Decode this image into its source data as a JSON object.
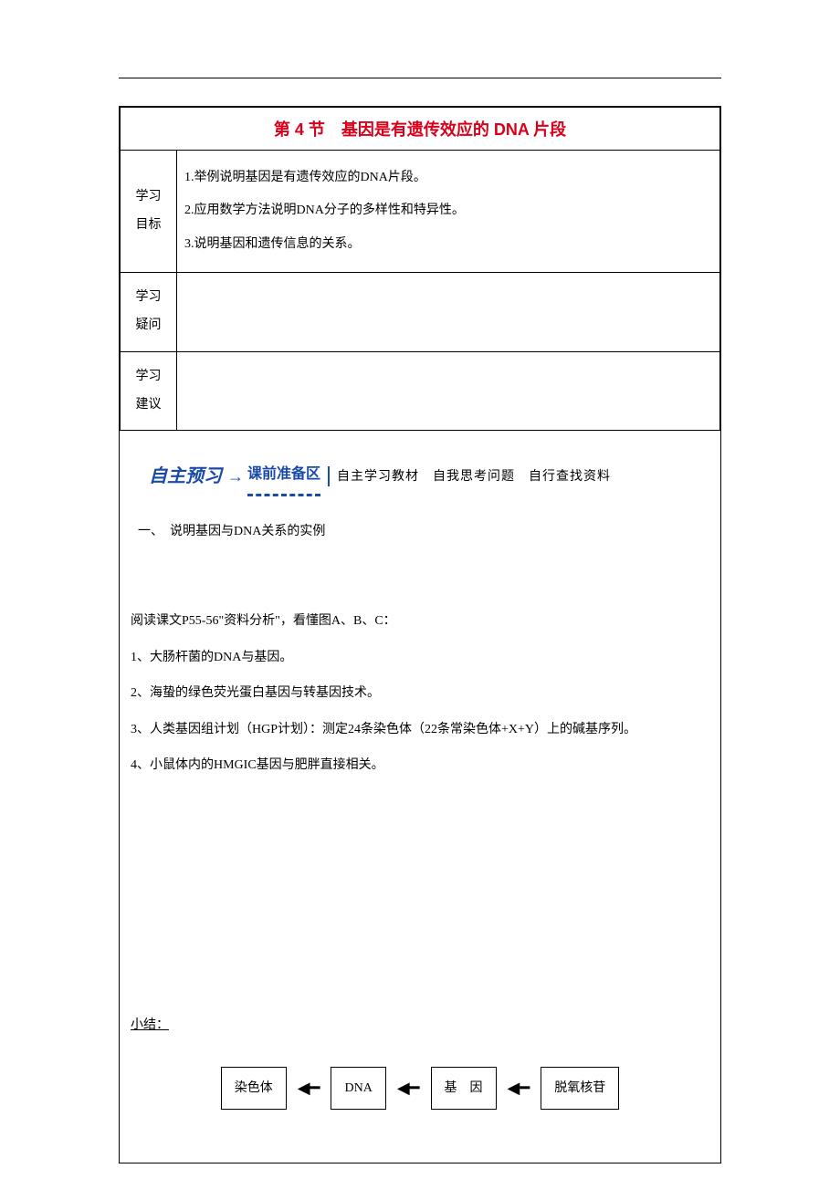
{
  "title": "第 4 节　基因是有遗传效应的 DNA 片段",
  "goals": {
    "label": "学习\n目标",
    "items": [
      "1.举例说明基因是有遗传效应的DNA片段。",
      "2.应用数学方法说明DNA分子的多样性和特异性。",
      "3.说明基因和遗传信息的关系。"
    ]
  },
  "questions_label": "学习\n疑问",
  "suggest_label": "学习\n建议",
  "banner": {
    "left": "自主预习",
    "mid": "课前准备区",
    "right": "自主学习教材　自我思考问题　自行查找资料"
  },
  "section1": {
    "heading": "一、　说明基因与DNA关系的实例",
    "intro": "阅读课文P55-56\"资料分析\"，看懂图A、B、C：",
    "points": [
      "1、大肠杆菌的DNA与基因。",
      "2、海蛰的绿色荧光蛋白基因与转基因技术。",
      "3、人类基因组计划（HGP计划）：测定24条染色体（22条常染色体+X+Y）上的碱基序列。",
      "4、小鼠体内的HMGIC基因与肥胖直接相关。"
    ]
  },
  "summary_label": "小结：",
  "diagram": {
    "b1": "染色体",
    "b2": "DNA",
    "b3": "基　因",
    "b4": "脱氧核苷"
  }
}
